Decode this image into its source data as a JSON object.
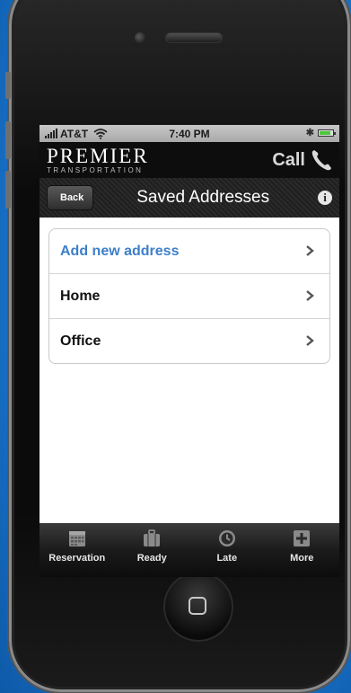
{
  "status": {
    "carrier": "AT&T",
    "time": "7:40 PM",
    "battery_level": 0.85,
    "battery_color": "#4cc93a"
  },
  "brand": {
    "name": "PREMIER",
    "subtitle": "TRANSPORTATION",
    "call_label": "Call",
    "call_icon": "phone-handset-icon"
  },
  "nav": {
    "back_label": "Back",
    "title": "Saved Addresses",
    "info_icon": "info-icon"
  },
  "addresses": [
    {
      "label": "Add new address",
      "color": "#3d7fc7",
      "icon": "chevron-right-icon"
    },
    {
      "label": "Home",
      "icon": "chevron-right-icon"
    },
    {
      "label": "Office",
      "icon": "chevron-right-icon"
    }
  ],
  "tabs": [
    {
      "label": "Reservation",
      "icon": "calendar-icon"
    },
    {
      "label": "Ready",
      "icon": "luggage-icon"
    },
    {
      "label": "Late",
      "icon": "clock-icon"
    },
    {
      "label": "More",
      "icon": "plus-icon"
    }
  ],
  "colors": {
    "background": "#1e7fd4",
    "link": "#3d7fc7",
    "tabbar": "#1b1b1b"
  }
}
